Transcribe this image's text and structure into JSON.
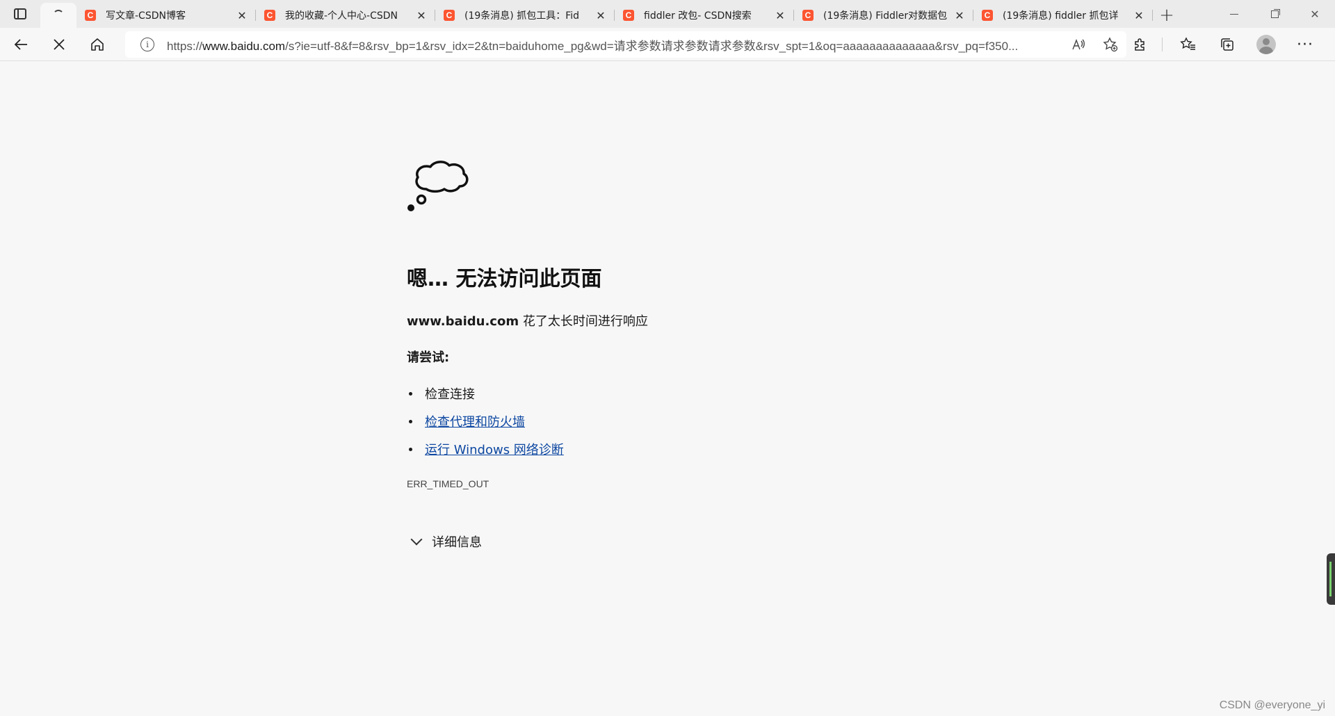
{
  "tabs": [
    {
      "title": "写文章-CSDN博客",
      "favicon": "C"
    },
    {
      "title": "我的收藏-个人中心-CSDN",
      "favicon": "C"
    },
    {
      "title": "(19条消息) 抓包工具：Fid",
      "favicon": "C"
    },
    {
      "title": "fiddler 改包- CSDN搜索",
      "favicon": "C"
    },
    {
      "title": "(19条消息) Fiddler对数据包",
      "favicon": "C"
    },
    {
      "title": "(19条消息) fiddler 抓包详",
      "favicon": "C"
    }
  ],
  "address_bar": {
    "url_prefix": "https://",
    "url_host": "www.baidu.com",
    "url_rest": "/s?ie=utf-8&f=8&rsv_bp=1&rsv_idx=2&tn=baiduhome_pg&wd=请求参数请求参数请求参数&rsv_spt=1&oq=aaaaaaaaaaaaaa&rsv_pq=f350..."
  },
  "error": {
    "headline": "嗯… 无法访问此页面",
    "host": "www.baidu.com",
    "message": "花了太长时间进行响应",
    "try_label": "请尝试:",
    "suggestions": [
      {
        "text": "检查连接",
        "link": false
      },
      {
        "text": "检查代理和防火墙",
        "link": true
      },
      {
        "text": "运行 Windows 网络诊断",
        "link": true
      }
    ],
    "code": "ERR_TIMED_OUT",
    "details_label": "详细信息"
  },
  "watermark": "CSDN @everyone_yi",
  "colors": {
    "favicon": "#fc5531",
    "link": "#0d47a1",
    "page_bg": "#f7f7f7"
  }
}
